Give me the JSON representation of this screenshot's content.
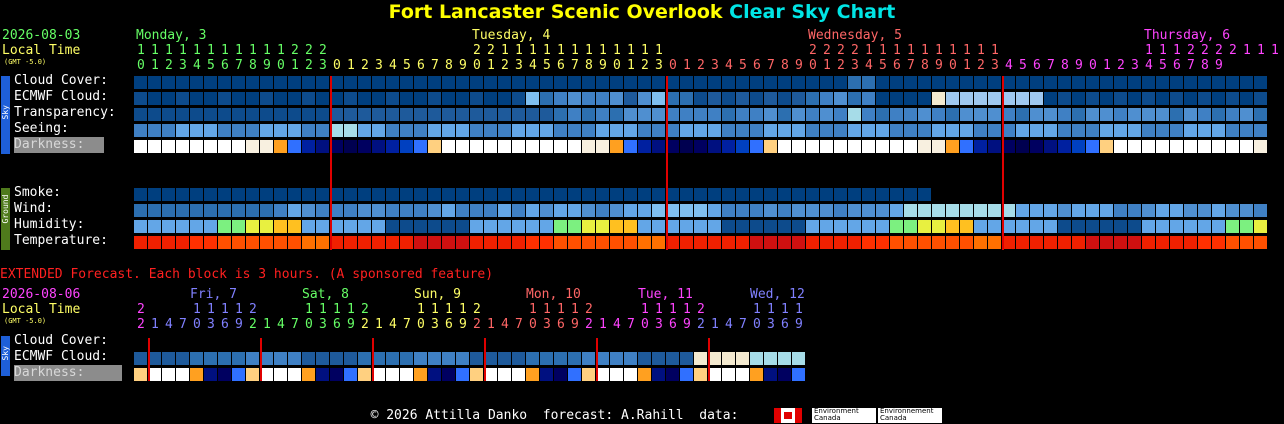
{
  "title": {
    "part1": "Fort Lancaster Scenic Overlook",
    "part2": "Clear Sky Chart"
  },
  "header": {
    "date": "2026-08-03",
    "local_time": "Local Time",
    "gmt": "(GMT -5.0)"
  },
  "days": [
    {
      "label": "Monday, 3",
      "color": "#66ff66"
    },
    {
      "label": "Tuesday, 4",
      "color": "#ffff66"
    },
    {
      "label": "Wednesday, 5",
      "color": "#ff6666"
    },
    {
      "label": "Thursday, 6",
      "color": "#ff44ff"
    }
  ],
  "hours_tens": "11111111111222221111111111112222111111111111122221111111111",
  "hours_units": "012345678901230123456789012345678901230123456789012345678901234567890123456789",
  "sky_tag": "Sky",
  "ground_tag": "Ground",
  "rows": {
    "cloud": "Cloud Cover:",
    "ecmwf": "ECMWF Cloud:",
    "transparency": "Transparency:",
    "seeing": "Seeing:",
    "darkness": "Darkness:",
    "smoke": "Smoke:",
    "wind": "Wind:",
    "humidity": "Humidity:",
    "temperature": "Temperature:"
  },
  "extended": {
    "note": "EXTENDED Forecast. Each block is 3 hours. (A sponsored feature)",
    "date": "2026-08-06",
    "local_time": "Local Time",
    "gmt": "(GMT -5.0)",
    "days": [
      {
        "label": "Fri, 7",
        "color": "#8080ff",
        "tens": "11112",
        "units": "1470369"
      },
      {
        "label": "Sat, 8",
        "color": "#66ff66",
        "tens": "11112",
        "units": "21470369"
      },
      {
        "label": "Sun, 9",
        "color": "#ffff66",
        "tens": "11112",
        "units": "21470369"
      },
      {
        "label": "Mon, 10",
        "color": "#ff6666",
        "tens": "11112",
        "units": "21470369"
      },
      {
        "label": "Tue, 11",
        "color": "#ff44ff",
        "tens": "11112",
        "units": "21470369"
      },
      {
        "label": "Wed, 12",
        "color": "#8080ff",
        "tens": "1111",
        "units": "21470369"
      }
    ],
    "first_day": {
      "tens": "2",
      "units": "2",
      "color": "#ff44ff"
    },
    "rows": {
      "cloud": "Cloud Cover:",
      "ecmwf": "ECMWF Cloud:",
      "darkness": "Darkness:"
    }
  },
  "footer": {
    "text": "© 2026 Attilla Danko  forecast: A.Rahill  data:",
    "ec1": "Environment\nCanada",
    "ec2": "Environnement\nCanada"
  },
  "colors": {
    "clear": "#003f7f",
    "sky_blue_light": "#63a6e7",
    "cloud_mid": "#2c6fb0",
    "midnight_line": "#e00000",
    "dark_sky": "#000000"
  }
}
